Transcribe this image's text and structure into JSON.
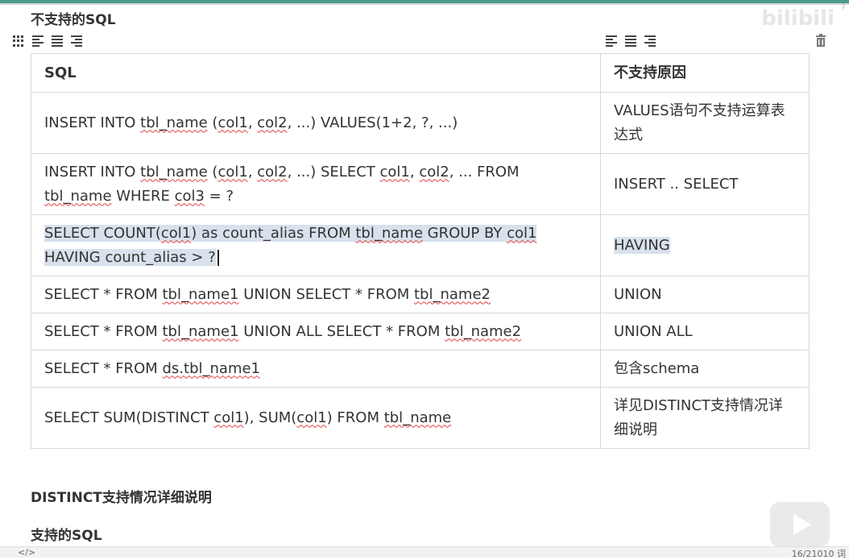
{
  "page": {
    "heading_top": "不支持的SQL",
    "heading_distinct": "DISTINCT支持情况详细说明",
    "heading_supported": "支持的SQL",
    "watermark": "bilibili",
    "help": "?"
  },
  "table": {
    "headers": [
      "SQL",
      "不支持原因"
    ],
    "rows": [
      {
        "sql": [
          "INSERT INTO ",
          {
            "s": "tbl_name"
          },
          " (",
          {
            "s": "col1"
          },
          ", ",
          {
            "s": "col2"
          },
          ", ...) VALUES(1+2, ?, ...)"
        ],
        "reason": "VALUES语句不支持运算表达式"
      },
      {
        "sql": [
          "INSERT INTO ",
          {
            "s": "tbl_name"
          },
          " (",
          {
            "s": "col1"
          },
          ", ",
          {
            "s": "col2"
          },
          ", ...) SELECT ",
          {
            "s": "col1"
          },
          ", ",
          {
            "s": "col2"
          },
          ", ... FROM ",
          {
            "s": "tbl_name"
          },
          " WHERE ",
          {
            "s": "col3"
          },
          " = ?"
        ],
        "reason": "INSERT .. SELECT"
      },
      {
        "sql": [
          "SELECT COUNT(",
          {
            "s": "col1"
          },
          ") as count_alias FROM ",
          {
            "s": "tbl_name"
          },
          " GROUP BY ",
          {
            "s": "col1"
          },
          " HAVING count_alias > ?"
        ],
        "reason": "HAVING",
        "highlight": true
      },
      {
        "sql": [
          "SELECT * FROM ",
          {
            "s": "tbl_name1"
          },
          " UNION SELECT * FROM ",
          {
            "s": "tbl_name2"
          }
        ],
        "reason": "UNION"
      },
      {
        "sql": [
          "SELECT * FROM ",
          {
            "s": "tbl_name1"
          },
          " UNION ALL SELECT * FROM ",
          {
            "s": "tbl_name2"
          }
        ],
        "reason": "UNION ALL"
      },
      {
        "sql": [
          "SELECT * FROM ",
          {
            "s": "ds.tbl_name1"
          }
        ],
        "reason": "包含schema"
      },
      {
        "sql": [
          "SELECT SUM(DISTINCT ",
          {
            "s": "col1"
          },
          "), SUM(",
          {
            "s": "col1"
          },
          ") FROM ",
          {
            "s": "tbl_name"
          }
        ],
        "reason": "详见DISTINCT支持情况详细说明"
      }
    ]
  },
  "status_bar": {
    "source_label": "</>",
    "word_count": "16/21010 词"
  },
  "colors": {
    "accent": "#4a9e8a",
    "selection": "#d8e1ec",
    "spellcheck": "#e04040"
  }
}
